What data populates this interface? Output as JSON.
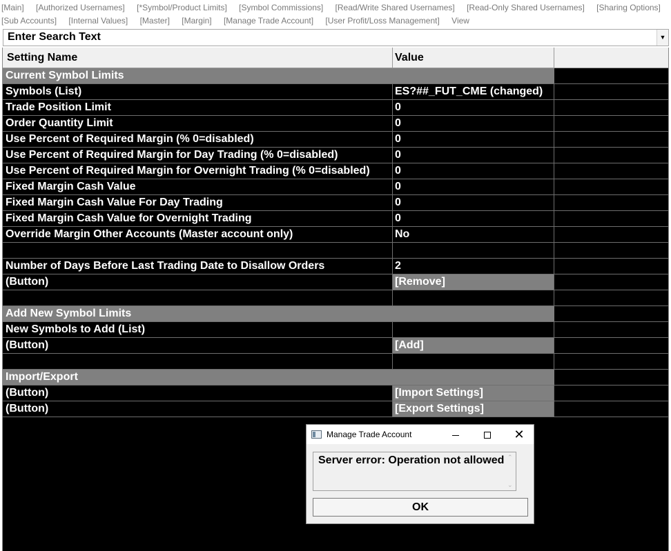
{
  "menu": {
    "row1": [
      "[Main]",
      "[Authorized Usernames]",
      "[*Symbol/Product Limits]",
      "[Symbol Commissions]",
      "[Read/Write Shared Usernames]",
      "[Read-Only Shared Usernames]",
      "[Sharing Options]"
    ],
    "row2": [
      "[Sub Accounts]",
      "[Internal Values]",
      "[Master]",
      "[Margin]",
      "[Manage Trade Account]",
      "[User Profit/Loss Management]",
      "View"
    ]
  },
  "search": {
    "text": "Enter Search Text"
  },
  "grid": {
    "headers": {
      "setting": "Setting Name",
      "value": "Value"
    },
    "rows": [
      {
        "type": "section",
        "name": "Current Symbol Limits",
        "value": ""
      },
      {
        "type": "data",
        "name": "Symbols (List)",
        "value": "ES?##_FUT_CME (changed)"
      },
      {
        "type": "data",
        "name": "Trade Position Limit",
        "value": "0"
      },
      {
        "type": "data",
        "name": "Order Quantity Limit",
        "value": "0"
      },
      {
        "type": "data",
        "name": "Use Percent of Required Margin (% 0=disabled)",
        "value": "0"
      },
      {
        "type": "data",
        "name": "Use Percent of Required Margin for Day Trading (% 0=disabled)",
        "value": "0"
      },
      {
        "type": "data",
        "name": "Use Percent of Required Margin for Overnight Trading (% 0=disabled)",
        "value": "0"
      },
      {
        "type": "data",
        "name": "Fixed Margin Cash Value",
        "value": "0"
      },
      {
        "type": "data",
        "name": "Fixed Margin Cash Value For Day Trading",
        "value": "0"
      },
      {
        "type": "data",
        "name": "Fixed Margin Cash Value for Overnight Trading",
        "value": "0"
      },
      {
        "type": "data",
        "name": "Override Margin Other Accounts (Master account only)",
        "value": "No"
      },
      {
        "type": "blank",
        "name": "",
        "value": ""
      },
      {
        "type": "data",
        "name": "Number of Days Before Last Trading Date to Disallow Orders",
        "value": "2"
      },
      {
        "type": "button",
        "name": " (Button)",
        "value": "[Remove]"
      },
      {
        "type": "blank",
        "name": "",
        "value": ""
      },
      {
        "type": "section",
        "name": "Add New Symbol Limits",
        "value": ""
      },
      {
        "type": "data",
        "name": "New Symbols to Add (List)",
        "value": ""
      },
      {
        "type": "button",
        "name": " (Button)",
        "value": "[Add]"
      },
      {
        "type": "blank",
        "name": "",
        "value": ""
      },
      {
        "type": "section",
        "name": "Import/Export",
        "value": ""
      },
      {
        "type": "button",
        "name": " (Button)",
        "value": "[Import Settings]"
      },
      {
        "type": "button",
        "name": " (Button)",
        "value": "[Export Settings]"
      }
    ]
  },
  "dialog": {
    "title": "Manage Trade Account",
    "message": "Server error: Operation not allowed",
    "ok_label": "OK",
    "close_glyph": "✕"
  },
  "colors": {
    "grid_background": "#000000",
    "section_background": "#808080",
    "header_background": "#f0f0f0",
    "menu_text": "#7a7a7a"
  }
}
